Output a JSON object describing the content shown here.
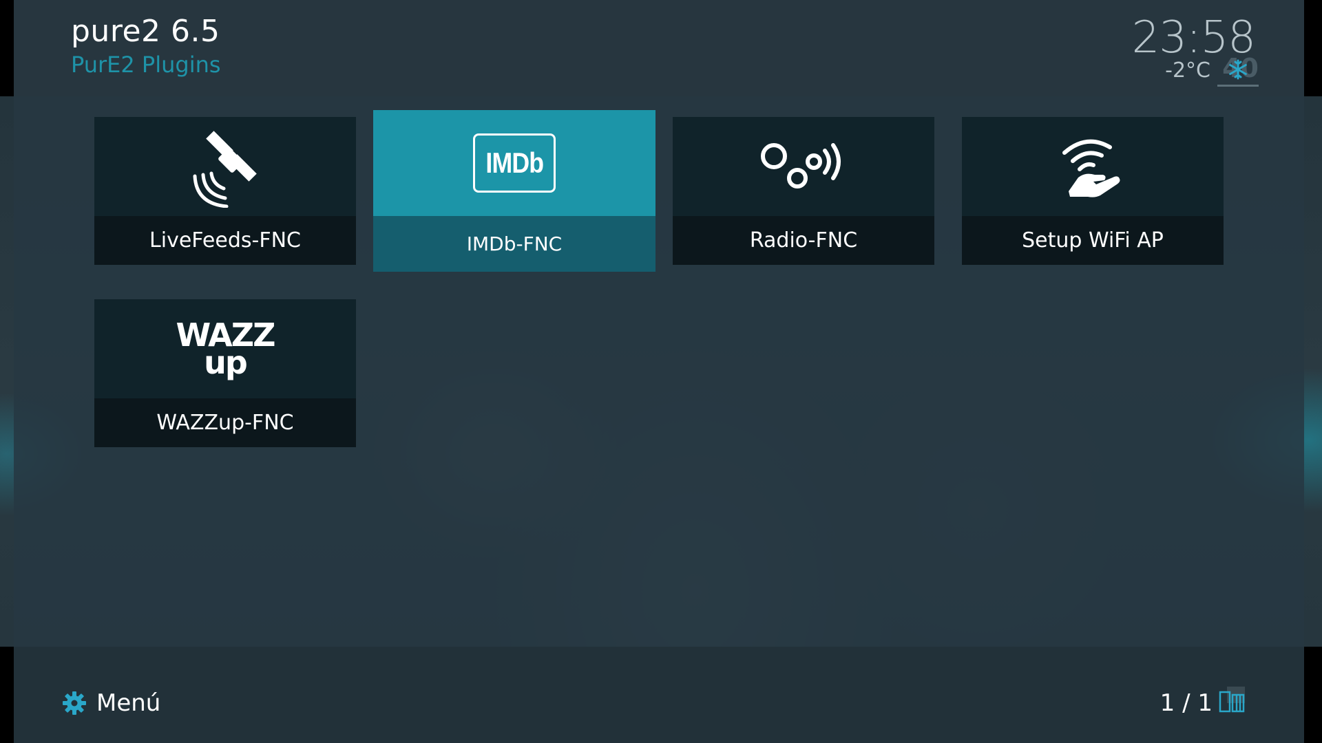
{
  "header": {
    "title": "pure2 6.5",
    "subtitle": "PurE2 Plugins"
  },
  "status": {
    "clock": "23:58",
    "temperature": "-2°C",
    "weather_icon": "snowflake-icon",
    "weather_code": "40"
  },
  "tiles": [
    {
      "label": "LiveFeeds-FNC",
      "icon": "satellite-icon",
      "focused": false
    },
    {
      "label": "IMDb-FNC",
      "icon": "imdb-logo",
      "logo_text": "IMDb",
      "focused": true
    },
    {
      "label": "Radio-FNC",
      "icon": "radio-waves-icon",
      "focused": false
    },
    {
      "label": "Setup WiFi AP",
      "icon": "wifi-hand-icon",
      "focused": false
    },
    {
      "label": "WAZZup-FNC",
      "icon": "wazzup-logo",
      "logo_line1": "WAZZ",
      "logo_line2": "up",
      "focused": false
    }
  ],
  "footer": {
    "menu_label": "Menú",
    "page_indicator": "1 / 1"
  },
  "colors": {
    "accent": "#1c95a8",
    "focused_label_bg": "#155e6e",
    "tile_bg": "#10232a",
    "label_bg": "#0c171c",
    "subtitle": "#1e93a8",
    "weather_icon": "#2aa7c9"
  }
}
